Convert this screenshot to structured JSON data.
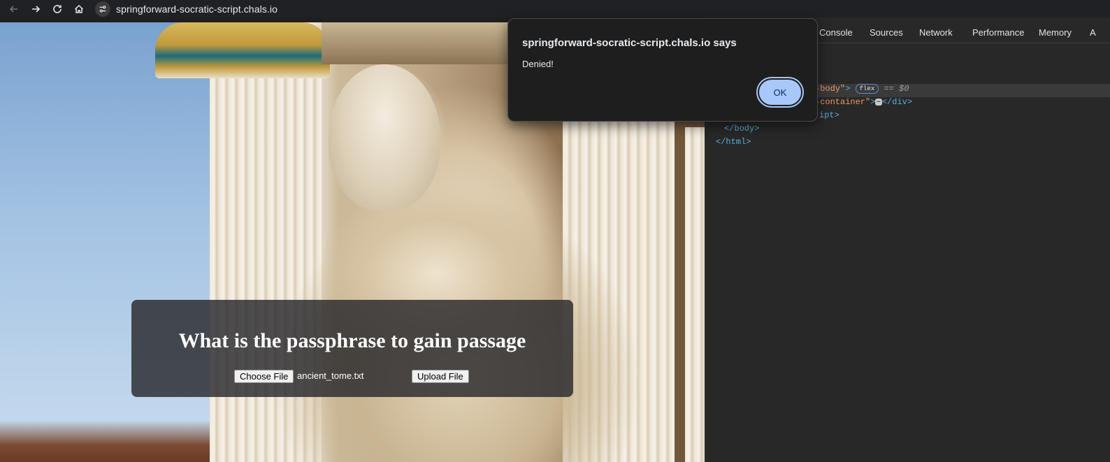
{
  "browser": {
    "url": "springforward-socratic-script.chals.io"
  },
  "page": {
    "heading": "What is the passphrase to gain passage",
    "choose_file_label": "Choose File",
    "selected_file": "ancient_tome.txt",
    "upload_label": "Upload File"
  },
  "dialog": {
    "title": "springforward-socratic-script.chals.io says",
    "message": "Denied!",
    "ok_label": "OK"
  },
  "devtools": {
    "tabs": [
      "Console",
      "Sources",
      "Network",
      "Performance",
      "Memory",
      "A"
    ],
    "code": {
      "line1_class": "-body\"",
      "line1_badge": "flex",
      "line1_ref": "== $0",
      "line2_class": "-container\"",
      "line2_close": "</div>",
      "line3": "ipt>",
      "line4": "</body>",
      "line5": "</html>"
    }
  },
  "colors": {
    "accent": "#a8c7fa",
    "panel_bg": "#28282c",
    "devtools_bg": "#282828",
    "tag_blue": "#5db0d7",
    "attr_orange": "#f29766"
  }
}
